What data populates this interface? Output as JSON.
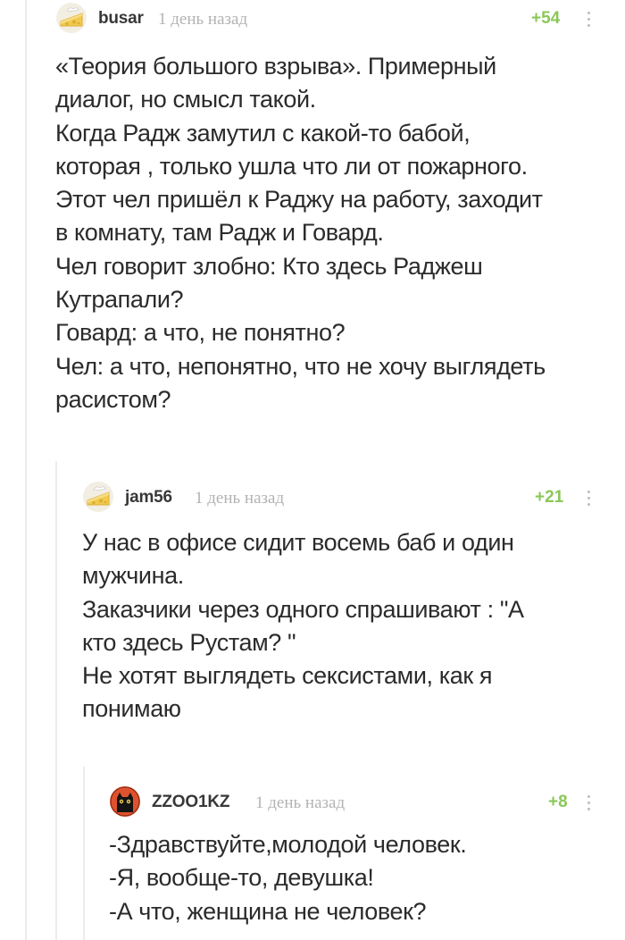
{
  "comments": [
    {
      "username": "busar",
      "time": "1 день назад",
      "rating": "+54",
      "avatar": "cheese-avatar-icon",
      "lines": [
        "«Теория большого взрыва». Примерный",
        "диалог, но смысл такой.",
        "Когда Радж замутил с какой-то бабой,",
        "которая , только ушла что ли от пожарного.",
        "Этот чел пришёл к Раджу на работу, заходит",
        "в комнату, там Радж и Говард.",
        "Чел говорит злобно: Кто здесь Раджеш",
        "Кутрапали?",
        "Говард: а что, не понятно?",
        "Чел: а что, непонятно, что не хочу выглядеть",
        "расистом?"
      ]
    },
    {
      "username": "jam56",
      "time": "1 день назад",
      "rating": "+21",
      "avatar": "cheese-avatar-icon",
      "lines": [
        "У нас в офисе сидит восемь баб и один",
        "мужчина.",
        "Заказчики через одного спрашивают : \"А",
        "кто здесь Рустам? \"",
        "Не хотят выглядеть сексистами, как я",
        "понимаю"
      ]
    },
    {
      "username": "ZZOO1KZ",
      "time": "1 день назад",
      "rating": "+8",
      "avatar": "black-cat-avatar-icon",
      "lines": [
        "-Здравствуйте,молодой человек.",
        "-Я, вообще-то, девушка!",
        "-А что, женщина не человек?"
      ]
    }
  ],
  "colors": {
    "rating": "#8ac858",
    "timestamp": "#b3b3b3",
    "username": "#383838",
    "text": "#2b2b2b",
    "thread_line": "#ececec"
  }
}
